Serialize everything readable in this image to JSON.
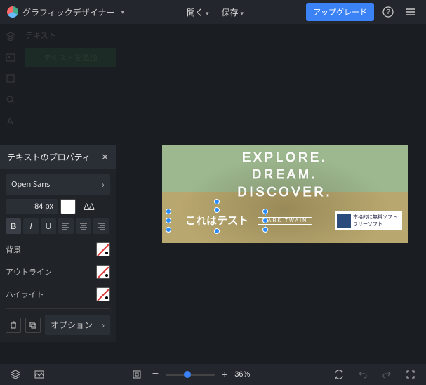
{
  "header": {
    "app_title": "グラフィックデザイナー",
    "open": "開く",
    "save": "保存",
    "upgrade": "アップグレード"
  },
  "left": {
    "section_label": "テキスト",
    "add_text": "テキストを追加"
  },
  "panel": {
    "title": "テキストのプロパティ",
    "font": "Open Sans",
    "size": "84",
    "unit": "px",
    "caps": "AA",
    "bg": "背景",
    "outline": "アウトライン",
    "highlight": "ハイライト",
    "options": "オプション"
  },
  "canvas": {
    "line1": "EXPLORE.",
    "line2": "DREAM.",
    "line3": "DISCOVER.",
    "selected": "これはテスト",
    "caption": "MARK TWAIN",
    "badge1": "本格的に無料ソフト",
    "badge2": "フリーソフト"
  },
  "bottom": {
    "zoom": "36%"
  }
}
